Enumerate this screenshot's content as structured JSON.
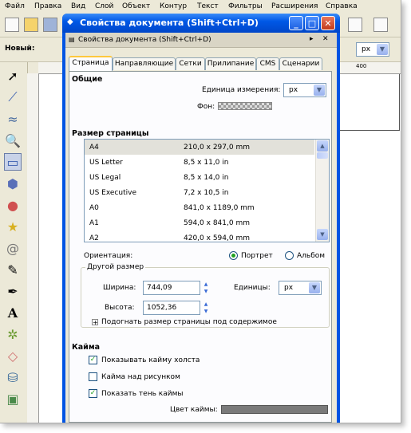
{
  "menu": [
    "Файл",
    "Правка",
    "Вид",
    "Слой",
    "Объект",
    "Контур",
    "Текст",
    "Фильтры",
    "Расширения",
    "Справка"
  ],
  "toolbar": {
    "tool_label": "Новый:",
    "unit_value": "px"
  },
  "ruler": {
    "tick_400": "400"
  },
  "dialog": {
    "title": "Свойства документа (Shift+Ctrl+D)",
    "subtitle": "Свойства документа (Shift+Ctrl+D)",
    "tabs": [
      "Страница",
      "Направляющие",
      "Сетки",
      "Прилипание",
      "CMS",
      "Сценарии"
    ],
    "general": {
      "heading": "Общие",
      "unit_label": "Единица измерения:",
      "unit_value": "px",
      "bg_label": "Фон:"
    },
    "page_size": {
      "heading": "Размер страницы",
      "rows": [
        {
          "name": "A4",
          "dims": "210,0 x 297,0 mm"
        },
        {
          "name": "US Letter",
          "dims": "8,5 x 11,0 in"
        },
        {
          "name": "US Legal",
          "dims": "8,5 x 14,0 in"
        },
        {
          "name": "US Executive",
          "dims": "7,2 x 10,5 in"
        },
        {
          "name": "A0",
          "dims": "841,0 x 1189,0 mm"
        },
        {
          "name": "A1",
          "dims": "594,0 x 841,0 mm"
        },
        {
          "name": "A2",
          "dims": "420,0 x 594,0 mm"
        }
      ]
    },
    "orientation": {
      "label": "Ориентация:",
      "portrait": "Портрет",
      "landscape": "Альбом"
    },
    "custom": {
      "legend": "Другой размер",
      "width_label": "Ширина:",
      "width_value": "744,09",
      "height_label": "Высота:",
      "height_value": "1052,36",
      "units_label": "Единицы:",
      "units_value": "px",
      "fit_label": "Подогнать размер страницы под содержимое"
    },
    "border": {
      "heading": "Кайма",
      "show_canvas_border": "Показывать кайму холста",
      "border_on_top": "Кайма над рисунком",
      "show_shadow": "Показать тень каймы",
      "color_label": "Цвет каймы:"
    }
  }
}
